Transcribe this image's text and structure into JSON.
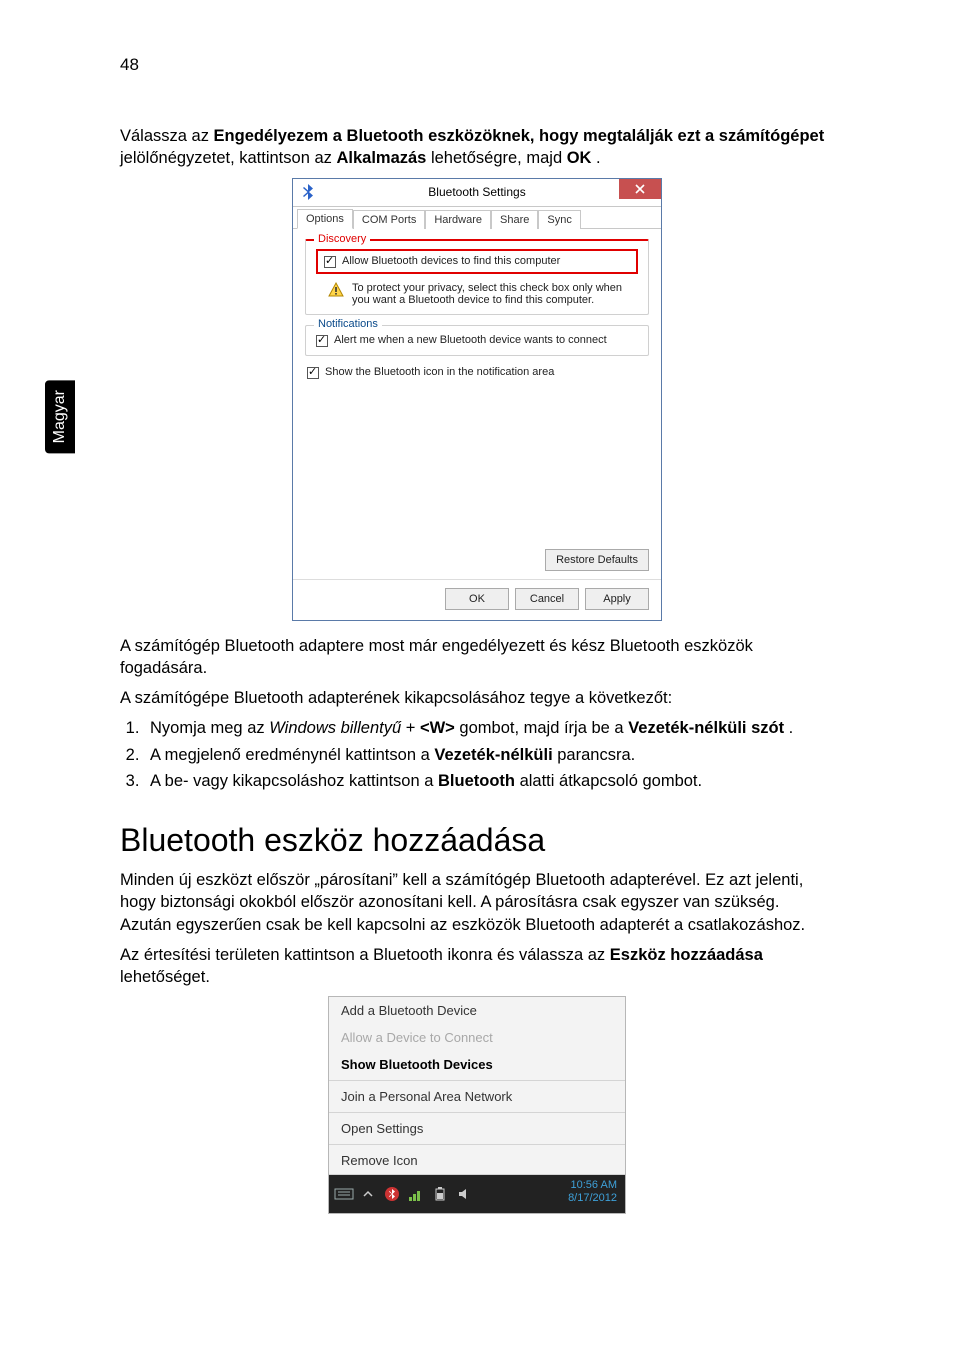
{
  "pageNumber": "48",
  "sidebarLang": "Magyar",
  "intro": {
    "pre": "Válassza az ",
    "b1": "Engedélyezem a Bluetooth eszközöknek, hogy megtalálják ezt a számítógépet",
    "mid1": " jelölőnégyzetet, kattintson az ",
    "b2": "Alkalmazás",
    "mid2": " lehetőségre, majd ",
    "b3": "OK",
    "end": "."
  },
  "dialog": {
    "title": "Bluetooth Settings",
    "tabs": [
      "Options",
      "COM Ports",
      "Hardware",
      "Share",
      "Sync"
    ],
    "discoveryLegend": "Discovery",
    "allowFind": "Allow Bluetooth devices to find this computer",
    "warn": "To protect your privacy, select this check box only when you want a Bluetooth device to find this computer.",
    "notifLegend": "Notifications",
    "alertConnect": "Alert me when a new Bluetooth device wants to connect",
    "showIcon": "Show the Bluetooth icon in the notification area",
    "restore": "Restore Defaults",
    "ok": "OK",
    "cancel": "Cancel",
    "apply": "Apply"
  },
  "afterDialog1": "A számítógép Bluetooth adaptere most már engedélyezett és kész Bluetooth eszközök fogadására.",
  "afterDialog2": "A számítógépe Bluetooth adapterének kikapcsolásához tegye a következőt:",
  "steps": {
    "s1_pre": "Nyomja meg az ",
    "s1_i": "Windows billentyű",
    "s1_mid1": " + ",
    "s1_b1": "<W>",
    "s1_mid2": " gombot, majd írja be a ",
    "s1_b2": "Vezeték-nélküli szót",
    "s1_end": ".",
    "s2_pre": "A megjelenő eredménynél kattintson a ",
    "s2_b": "Vezeték-nélküli",
    "s2_end": " parancsra.",
    "s3_pre": "A be- vagy kikapcsoláshoz kattintson a ",
    "s3_b": "Bluetooth",
    "s3_end": " alatti átkapcsoló gombot."
  },
  "sectionHead": "Bluetooth eszköz hozzáadása",
  "addPara1": "Minden új eszközt először „párosítani” kell a számítógép Bluetooth adapterével. Ez azt jelenti, hogy biztonsági okokból először azonosítani kell. A párosításra csak egyszer van szükség. Azután egyszerűen csak be kell kapcsolni az eszközök Bluetooth adapterét a csatlakozáshoz.",
  "addPara2_pre": "Az értesítési területen kattintson a Bluetooth ikonra és válassza az ",
  "addPara2_b": "Eszköz hozzáadása",
  "addPara2_end": " lehetőséget.",
  "tray": {
    "addDevice": "Add a Bluetooth Device",
    "allowConnect": "Allow a Device to Connect",
    "showDevices": "Show Bluetooth Devices",
    "joinPan": "Join a Personal Area Network",
    "openSettings": "Open Settings",
    "removeIcon": "Remove Icon",
    "time": "10:56 AM",
    "date": "8/17/2012"
  }
}
